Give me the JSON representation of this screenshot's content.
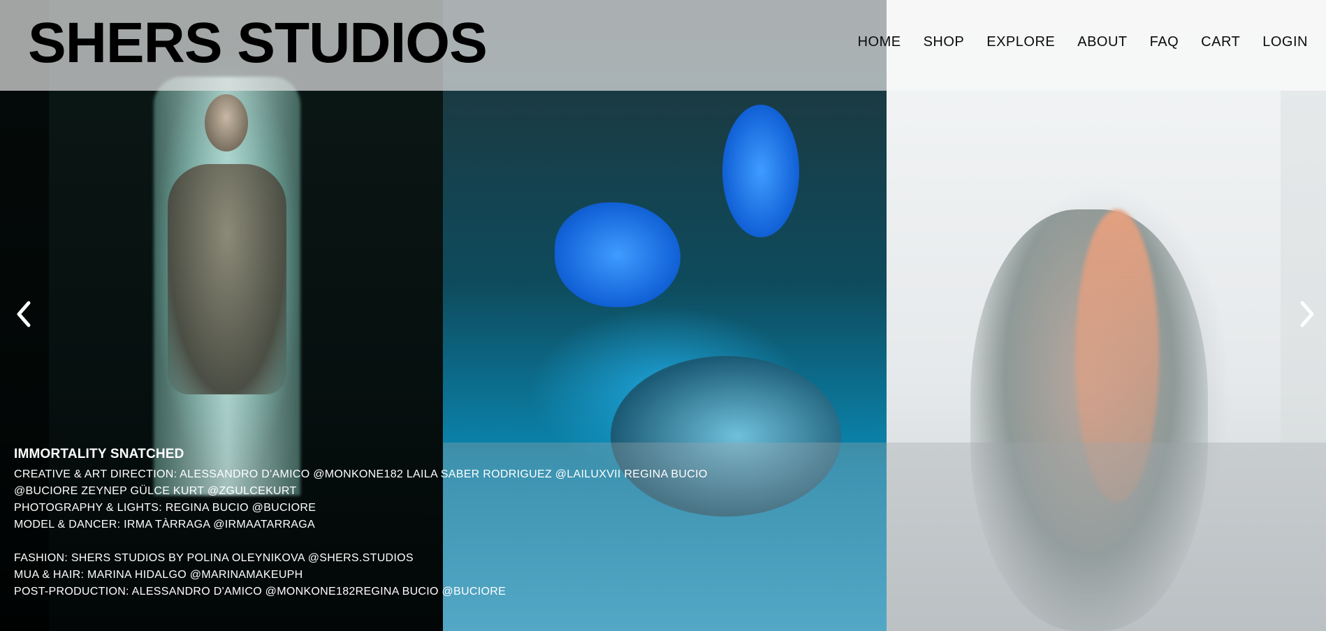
{
  "header": {
    "site_title": "SHERS STUDIOS",
    "nav": [
      {
        "label": "HOME"
      },
      {
        "label": "SHOP"
      },
      {
        "label": "EXPLORE"
      },
      {
        "label": "ABOUT"
      },
      {
        "label": "FAQ"
      },
      {
        "label": "CART"
      },
      {
        "label": "LOGIN"
      }
    ]
  },
  "slider": {
    "prev_icon": "chevron-left-icon",
    "next_icon": "chevron-right-icon",
    "arrow_color": "#ffffff"
  },
  "caption": {
    "title": "IMMORTALITY SNATCHED",
    "lines": [
      "CREATIVE & ART DIRECTION: ALESSANDRO D'AMICO @MONKONE182 LAILA SABER RODRIGUEZ @LAILUXVII REGINA BUCIO",
      "@BUCIORE ZEYNEP GÜLCE KURT @ZGULCEKURT",
      "PHOTOGRAPHY & LIGHTS: REGINA BUCIO @BUCIORE",
      "MODEL & DANCER: IRMA TÀRRAGA @IRMAATARRAGA",
      "FASHION: SHERS STUDIOS BY POLINA OLEYNIKOVA @SHERS.STUDIOS",
      "MUA & HAIR: MARINA HIDALGO @MARINAMAKEUPH",
      "POST-PRODUCTION: ALESSANDRO D'AMICO @MONKONE182REGINA BUCIO @BUCIORE"
    ]
  },
  "colors": {
    "text_dark": "#000000",
    "text_light": "#ffffff",
    "accent_cyan": "#2ba9d6",
    "glove_blue": "#1160d6"
  }
}
